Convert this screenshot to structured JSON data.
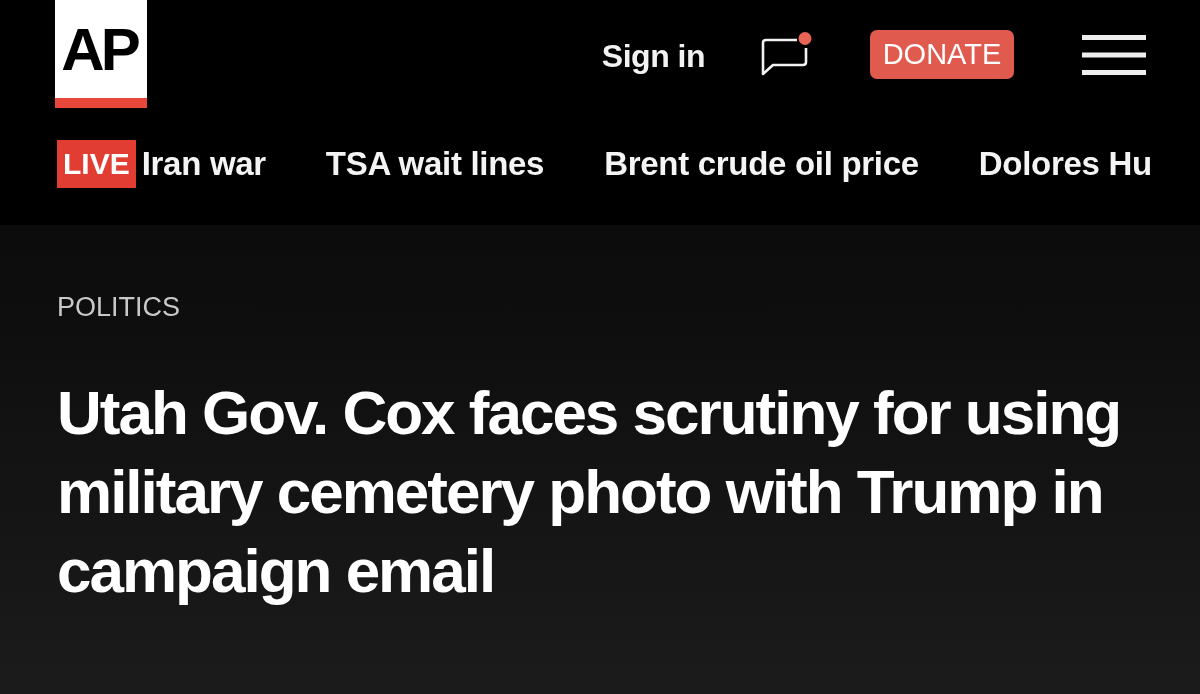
{
  "header": {
    "logo": {
      "text": "AP"
    },
    "sign_in": "Sign in",
    "messages": {
      "unread": true
    },
    "donate": "DONATE"
  },
  "trending": [
    {
      "label": "Iran war",
      "badge": "LIVE"
    },
    {
      "label": "TSA wait lines"
    },
    {
      "label": "Brent crude oil price"
    },
    {
      "label": "Dolores Hu"
    }
  ],
  "article": {
    "section": "POLITICS",
    "headline": "Utah Gov. Cox faces scrutiny for using military cemetery photo with Trump in campaign email"
  }
}
